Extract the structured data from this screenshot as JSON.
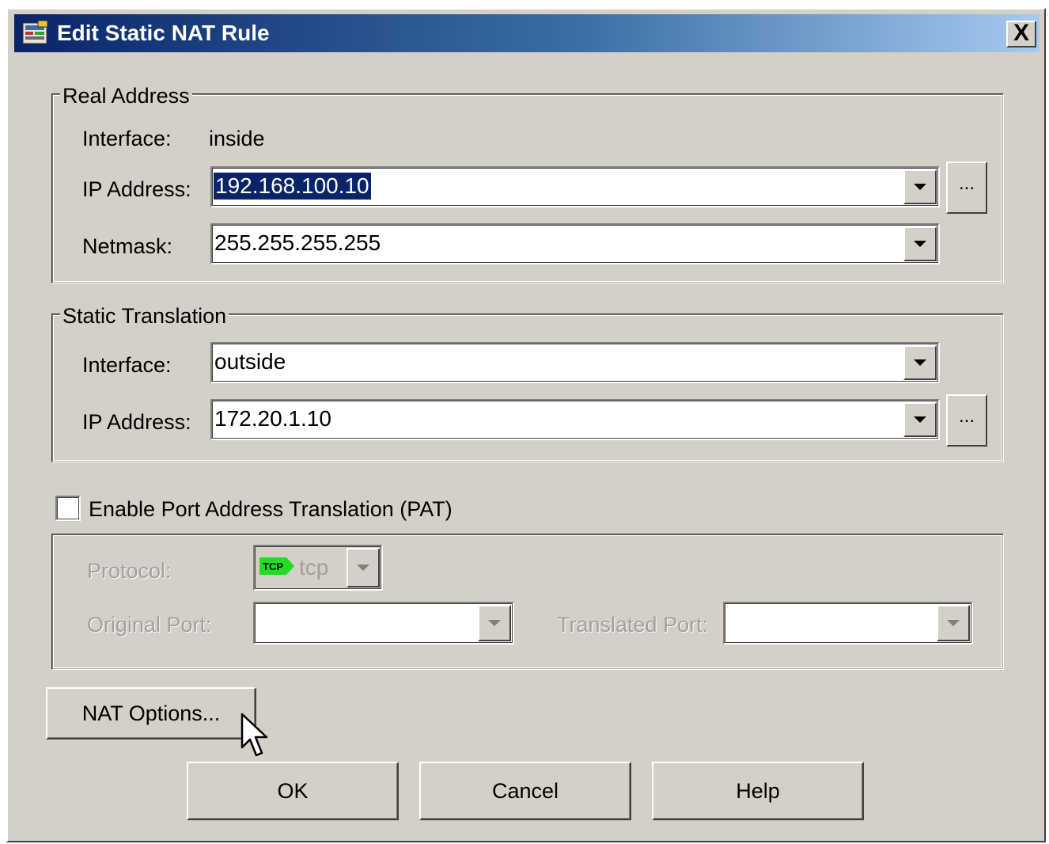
{
  "window": {
    "title": "Edit Static NAT Rule",
    "close_label": "X",
    "icon": "nat-rule-icon"
  },
  "real_address": {
    "legend": "Real Address",
    "interface_label": "Interface:",
    "interface_value": "inside",
    "ip_label": "IP Address:",
    "ip_value": "192.168.100.10",
    "netmask_label": "Netmask:",
    "netmask_value": "255.255.255.255",
    "browse_label": "..."
  },
  "static_translation": {
    "legend": "Static Translation",
    "interface_label": "Interface:",
    "interface_value": "outside",
    "ip_label": "IP Address:",
    "ip_value": "172.20.1.10",
    "browse_label": "..."
  },
  "pat": {
    "checkbox_label": "Enable Port Address Translation (PAT)",
    "checked": false,
    "protocol_label": "Protocol:",
    "protocol_value": "tcp",
    "protocol_icon_text": "TCP",
    "original_port_label": "Original Port:",
    "original_port_value": "",
    "translated_port_label": "Translated Port:",
    "translated_port_value": ""
  },
  "buttons": {
    "nat_options": "NAT Options...",
    "ok": "OK",
    "cancel": "Cancel",
    "help": "Help"
  },
  "colors": {
    "titlebar_start": "#0a246a",
    "titlebar_end": "#a6caf0",
    "face": "#d4d0c8",
    "selection": "#0a246a",
    "tcp_badge": "#22dd22"
  }
}
